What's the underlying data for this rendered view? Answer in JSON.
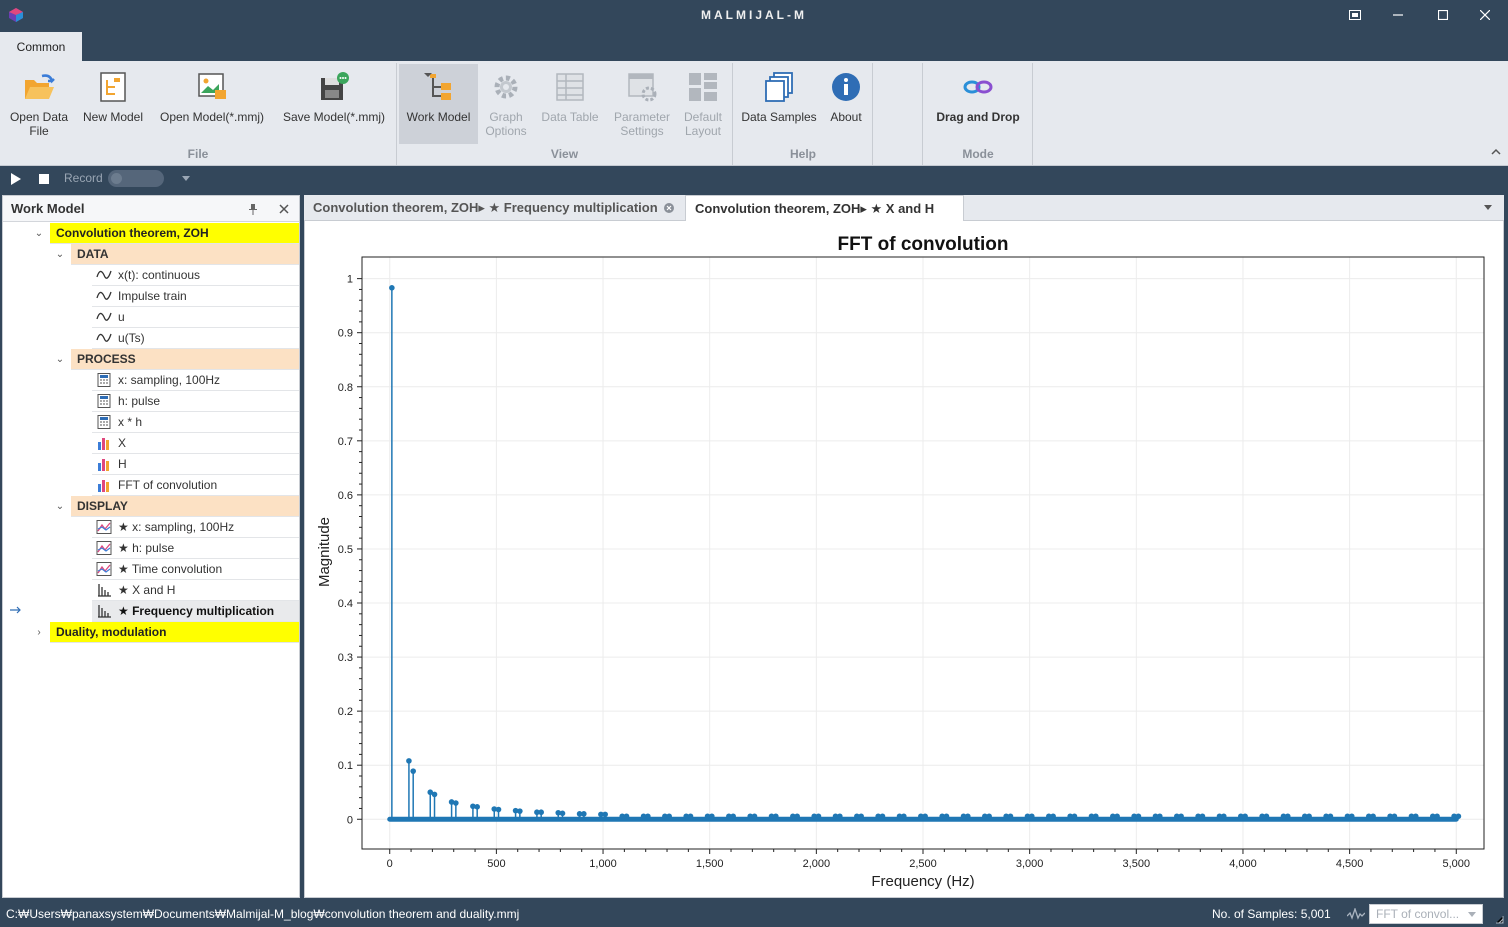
{
  "window": {
    "title": "MALMIJAL-M"
  },
  "ribbon": {
    "tab": "Common",
    "buttons": {
      "open_data": [
        "Open Data",
        "File"
      ],
      "new_model": "New Model",
      "open_model": "Open Model(*.mmj)",
      "save_model": "Save Model(*.mmj)",
      "work_model": "Work Model",
      "graph_options": [
        "Graph",
        "Options"
      ],
      "data_table": "Data Table",
      "parameter_settings": [
        "Parameter",
        "Settings"
      ],
      "default_layout": [
        "Default",
        "Layout"
      ],
      "data_samples": "Data Samples",
      "about": "About",
      "drag_drop": "Drag and Drop"
    },
    "groups": {
      "file": "File",
      "view": "View",
      "help": "Help",
      "mode": "Mode"
    }
  },
  "toolbar": {
    "record_label": "Record"
  },
  "work_model": {
    "title": "Work Model",
    "tree": {
      "root1": "Convolution theorem, ZOH",
      "data_cat": "DATA",
      "data_items": [
        "x(t): continuous",
        "Impulse train",
        "u",
        "u(Ts)"
      ],
      "process_cat": "PROCESS",
      "process_items": [
        "x: sampling, 100Hz",
        "h: pulse",
        "x * h",
        "X",
        "H",
        "FFT of convolution"
      ],
      "display_cat": "DISPLAY",
      "display_items": [
        "★ x: sampling, 100Hz",
        "★ h: pulse",
        "★ Time convolution",
        "★ X and H",
        "★ Frequency multiplication"
      ],
      "root2": "Duality, modulation"
    }
  },
  "doc_tabs": [
    {
      "label": "Convolution theorem, ZOH▸ ★ Frequency multiplication"
    },
    {
      "label": "Convolution theorem, ZOH▸ ★ X and H"
    }
  ],
  "chart_data": {
    "type": "scatter",
    "title": "FFT of convolution",
    "xlabel": "Frequency (Hz)",
    "ylabel": "Magnitude",
    "xlim": [
      -130,
      5130
    ],
    "ylim": [
      -0.055,
      1.04
    ],
    "x_ticks": [
      0,
      500,
      1000,
      1500,
      2000,
      2500,
      3000,
      3500,
      4000,
      4500,
      5000
    ],
    "x_tick_labels": [
      "0",
      "500",
      "1,000",
      "1,500",
      "2,000",
      "2,500",
      "3,000",
      "3,500",
      "4,000",
      "4,500",
      "5,000"
    ],
    "y_ticks": [
      0,
      0.1,
      0.2,
      0.3,
      0.4,
      0.5,
      0.6,
      0.7,
      0.8,
      0.9,
      1
    ],
    "y_tick_labels": [
      "0",
      "0.1",
      "0.2",
      "0.3",
      "0.4",
      "0.5",
      "0.6",
      "0.7",
      "0.8",
      "0.9",
      "1"
    ],
    "grid": true,
    "series": [
      {
        "style": "stem",
        "color": "#1f77b4",
        "points": [
          [
            10,
            0.983
          ],
          [
            90,
            0.108
          ],
          [
            110,
            0.089
          ],
          [
            190,
            0.05
          ],
          [
            210,
            0.046
          ],
          [
            290,
            0.032
          ],
          [
            310,
            0.03
          ],
          [
            390,
            0.024
          ],
          [
            410,
            0.023
          ],
          [
            490,
            0.019
          ],
          [
            510,
            0.018
          ],
          [
            590,
            0.016
          ],
          [
            610,
            0.015
          ],
          [
            690,
            0.013
          ],
          [
            710,
            0.013
          ],
          [
            790,
            0.012
          ],
          [
            810,
            0.011
          ],
          [
            890,
            0.01
          ],
          [
            910,
            0.01
          ],
          [
            990,
            0.009
          ],
          [
            1010,
            0.009
          ]
        ]
      }
    ]
  },
  "status": {
    "path": "C:₩Users₩panaxsystem₩Documents₩Malmijal-M_blog₩convolution theorem and duality.mmj",
    "samples": "No. of Samples: 5,001",
    "combo": "FFT of convol..."
  },
  "colors": {
    "titlebar": "#33475b",
    "ribbon": "#e6e9ee",
    "root_node": "#ffff00",
    "category_node": "#fce1c4",
    "stem": "#1f77b4"
  }
}
